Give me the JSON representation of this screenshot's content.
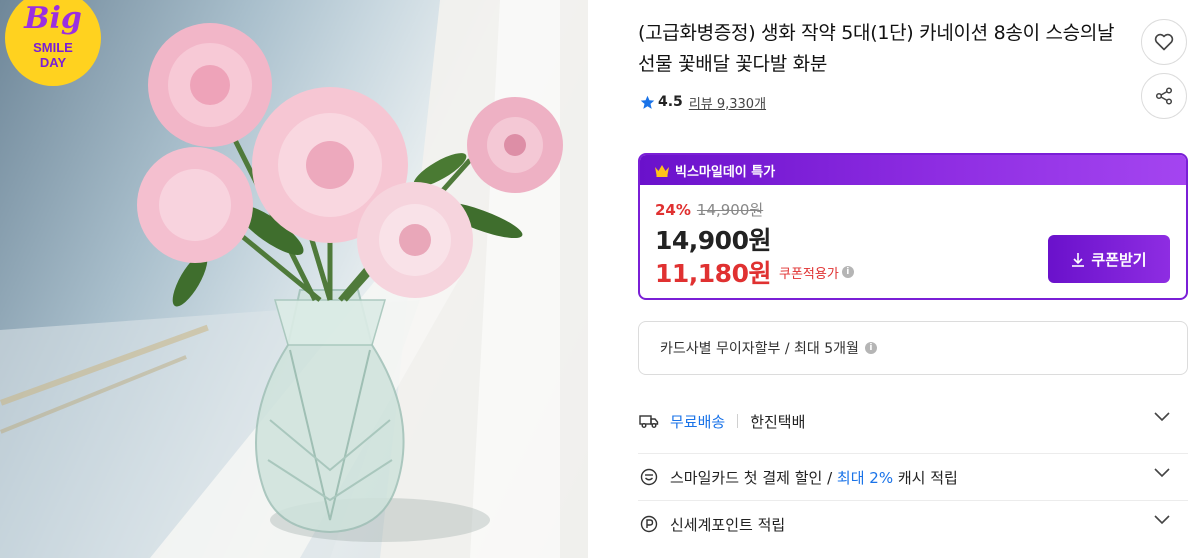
{
  "image": {
    "badge_big": "Big",
    "badge_line1": "SMILE",
    "badge_line2": "DAY"
  },
  "product": {
    "title": "(고급화병증정) 생화 작약 5대(1단) 카네이션 8송이 스승의날 선물 꽃배달 꽃다발 화분",
    "rating": "4.5",
    "review_label": "리뷰 9,330개"
  },
  "actions": {
    "like_icon": "heart-icon",
    "share_icon": "share-icon"
  },
  "deal": {
    "header": "빅스마일데이 특가",
    "discount_pct": "24%",
    "original_price": "14,900원",
    "sale_price": "14,900원",
    "coupon_price": "11,180원",
    "coupon_label": "쿠폰적용가",
    "coupon_button": "쿠폰받기"
  },
  "card": {
    "text": "카드사별 무이자할부 / 최대 5개월"
  },
  "shipping": {
    "free": "무료배송",
    "carrier": "한진택배"
  },
  "smilecard": {
    "prefix": "스마일카드 첫 결제 할인 / ",
    "highlight": "최대 2%",
    "suffix": " 캐시 적립"
  },
  "points": {
    "text": "신세계포인트 적립"
  },
  "colors": {
    "accent_purple": "#7a1fd6",
    "sale_red": "#e03131",
    "link_blue": "#1a73e8",
    "star_blue": "#1a73e8"
  }
}
